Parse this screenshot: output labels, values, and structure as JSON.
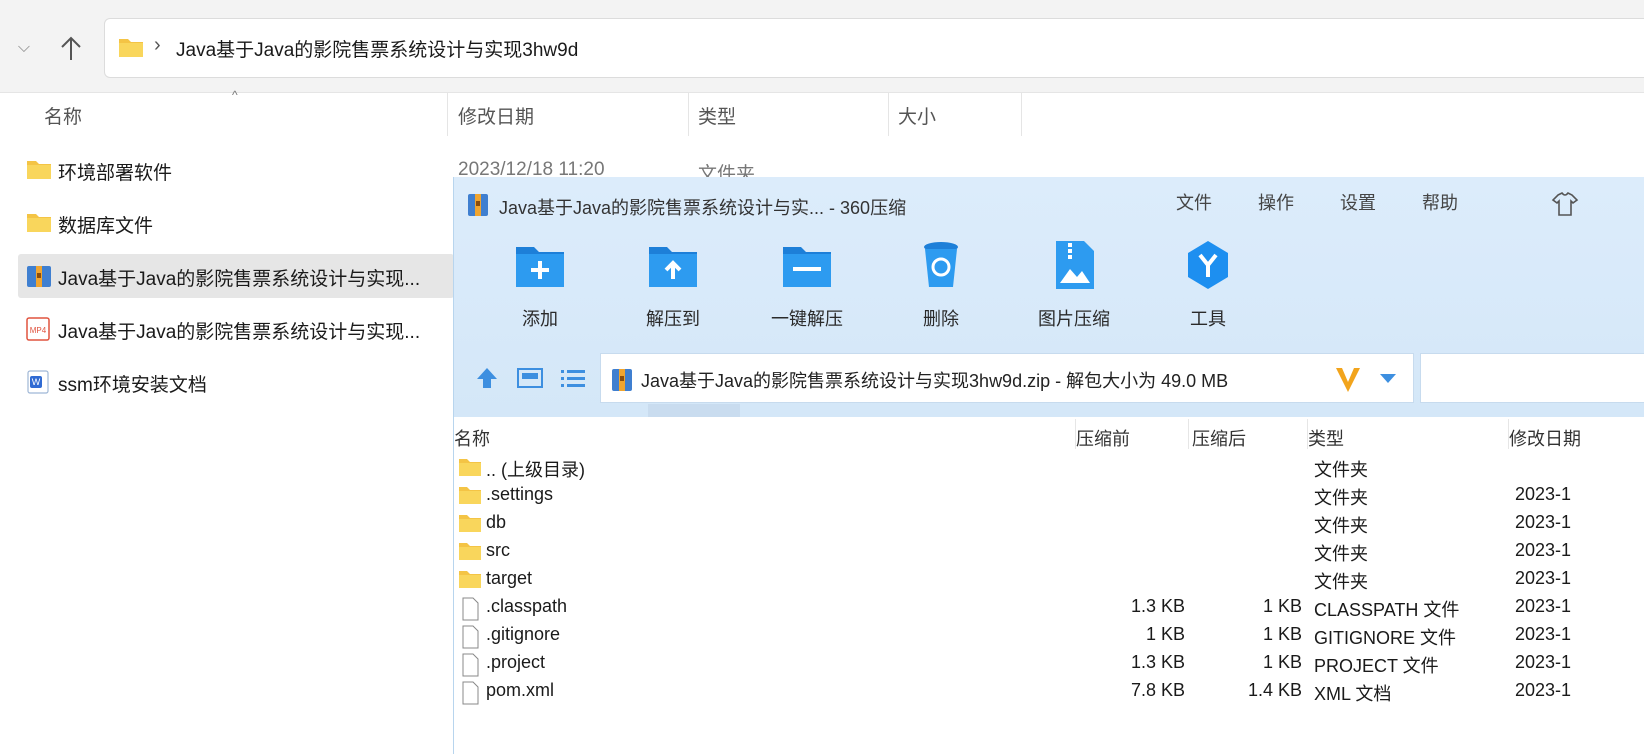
{
  "explorer": {
    "address_path": "Java基于Java的影院售票系统设计与实现3hw9d",
    "columns": [
      "名称",
      "修改日期",
      "类型",
      "大小"
    ],
    "items": [
      {
        "name": "环境部署软件",
        "icon": "folder-icon",
        "date": "2023/12/18 11:20",
        "type": "文件夹"
      },
      {
        "name": "数据库文件",
        "icon": "folder-icon"
      },
      {
        "name": "Java基于Java的影院售票系统设计与实现...",
        "icon": "zip-archive-icon",
        "selected": true
      },
      {
        "name": "Java基于Java的影院售票系统设计与实现...",
        "icon": "mp4-file-icon"
      },
      {
        "name": "ssm环境安装文档",
        "icon": "word-doc-icon"
      }
    ]
  },
  "zip_app": {
    "title": "Java基于Java的影院售票系统设计与实... - 360压缩",
    "menu": [
      "文件",
      "操作",
      "设置",
      "帮助"
    ],
    "toolbar": [
      {
        "label": "添加",
        "icon": "add-folder-icon"
      },
      {
        "label": "解压到",
        "icon": "extract-to-icon"
      },
      {
        "label": "一键解压",
        "icon": "one-click-extract-icon"
      },
      {
        "label": "删除",
        "icon": "delete-bin-icon"
      },
      {
        "label": "图片压缩",
        "icon": "image-compress-icon"
      },
      {
        "label": "工具",
        "icon": "tools-icon"
      }
    ],
    "path_text": "Java基于Java的影院售票系统设计与实现3hw9d.zip - 解包大小为 49.0 MB",
    "columns": {
      "name": "名称",
      "before": "压缩前",
      "after": "压缩后",
      "type": "类型",
      "date": "修改日期"
    },
    "files": [
      {
        "name": ".. (上级目录)",
        "icon": "folder-icon",
        "before": "",
        "after": "",
        "type": "文件夹",
        "date": ""
      },
      {
        "name": ".settings",
        "icon": "folder-icon",
        "before": "",
        "after": "",
        "type": "文件夹",
        "date": "2023-1"
      },
      {
        "name": "db",
        "icon": "folder-icon",
        "before": "",
        "after": "",
        "type": "文件夹",
        "date": "2023-1"
      },
      {
        "name": "src",
        "icon": "folder-icon",
        "before": "",
        "after": "",
        "type": "文件夹",
        "date": "2023-1"
      },
      {
        "name": "target",
        "icon": "folder-icon",
        "before": "",
        "after": "",
        "type": "文件夹",
        "date": "2023-1"
      },
      {
        "name": ".classpath",
        "icon": "file-icon",
        "before": "1.3 KB",
        "after": "1 KB",
        "type": "CLASSPATH 文件",
        "date": "2023-1"
      },
      {
        "name": ".gitignore",
        "icon": "file-icon",
        "before": "1 KB",
        "after": "1 KB",
        "type": "GITIGNORE 文件",
        "date": "2023-1"
      },
      {
        "name": ".project",
        "icon": "file-icon",
        "before": "1.3 KB",
        "after": "1 KB",
        "type": "PROJECT 文件",
        "date": "2023-1"
      },
      {
        "name": "pom.xml",
        "icon": "file-icon",
        "before": "7.8 KB",
        "after": "1.4 KB",
        "type": "XML 文档",
        "date": "2023-1"
      }
    ]
  }
}
